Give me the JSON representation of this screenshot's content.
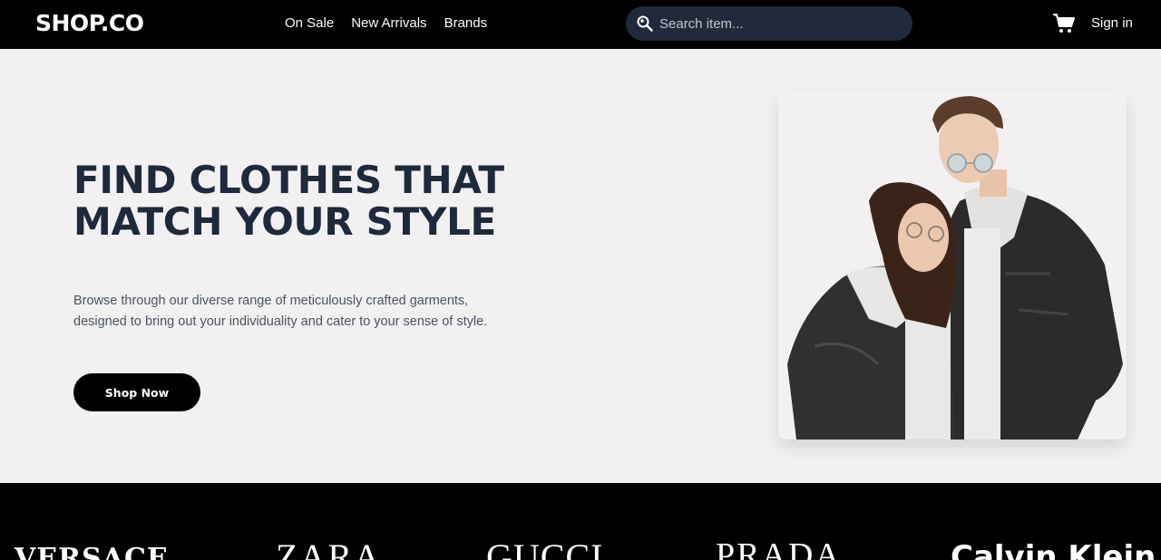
{
  "nav": {
    "logo": "SHOP.CO",
    "links": [
      "On Sale",
      "New Arrivals",
      "Brands"
    ],
    "search_placeholder": "Search item...",
    "cart_icon": "cart-icon",
    "signin": "Sign in"
  },
  "hero": {
    "title": "FIND CLOTHES THAT MATCH YOUR STYLE",
    "description": "Browse through our diverse range of meticulously crafted garments, designed to bring out your individuality and cater to your sense of style.",
    "button": "Shop Now",
    "image_subject": "couple-in-denim-jackets"
  },
  "brands": [
    "VERSACE",
    "ZARA",
    "GUCCI",
    "PRADA",
    "Calvin Klein"
  ],
  "colors": {
    "nav_bg": "#000000",
    "hero_bg": "#f2f0f1",
    "heading": "#1e293b",
    "search_bg": "#212a3a",
    "button_bg": "#000000"
  }
}
